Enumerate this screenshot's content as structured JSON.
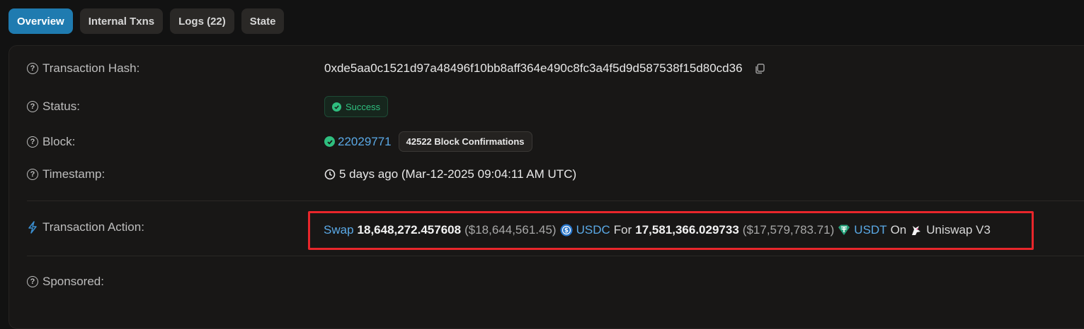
{
  "tabs": [
    {
      "label": "Overview"
    },
    {
      "label": "Internal Txns"
    },
    {
      "label": "Logs (22)"
    },
    {
      "label": "State"
    }
  ],
  "rows": {
    "hash": {
      "label": "Transaction Hash:",
      "value": "0xde5aa0c1521d97a48496f10bb8aff364e490c8fc3a4f5d9d587538f15d80cd36"
    },
    "status": {
      "label": "Status:",
      "value": "Success"
    },
    "block": {
      "label": "Block:",
      "number": "22029771",
      "confirmations": "42522 Block Confirmations"
    },
    "timestamp": {
      "label": "Timestamp:",
      "value": "5 days ago (Mar-12-2025 09:04:11 AM UTC)"
    },
    "action": {
      "label": "Transaction Action:",
      "verb": "Swap",
      "amount_in": "18,648,272.457608",
      "usd_in": "($18,644,561.45)",
      "token_in": "USDC",
      "for_word": "For",
      "amount_out": "17,581,366.029733",
      "usd_out": "($17,579,783.71)",
      "token_out": "USDT",
      "on_word": "On",
      "dex": "Uniswap V3"
    },
    "sponsored": {
      "label": "Sponsored:"
    }
  },
  "colors": {
    "accent": "#1f7bb0",
    "success": "#2fbf7f",
    "link": "#5aa9e6",
    "highlight_border": "#e8262b"
  },
  "icons": {
    "help": "question-circle-icon",
    "copy": "copy-icon",
    "check": "check-circle-icon",
    "clock": "clock-icon",
    "lightning": "lightning-icon",
    "usdc": "usdc-token-icon",
    "usdt": "usdt-token-icon",
    "uniswap": "uniswap-unicorn-icon"
  }
}
